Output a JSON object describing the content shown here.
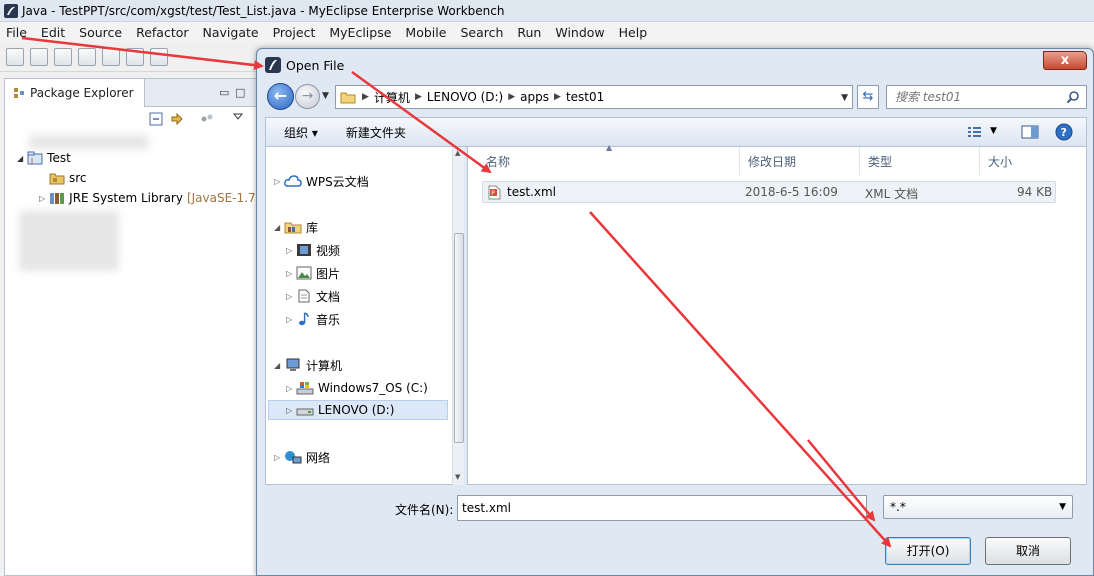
{
  "window": {
    "title": "Java - TestPPT/src/com/xgst/test/Test_List.java - MyEclipse Enterprise Workbench"
  },
  "menubar": {
    "items": [
      "File",
      "Edit",
      "Source",
      "Refactor",
      "Navigate",
      "Project",
      "MyEclipse",
      "Mobile",
      "Search",
      "Run",
      "Window",
      "Help"
    ]
  },
  "package_explorer": {
    "tab_label": "Package Explorer",
    "project": "Test",
    "src": "src",
    "jre": "JRE System Library",
    "jre_version": "[JavaSE-1.7"
  },
  "dialog": {
    "title": "Open File",
    "close_glyph": "x",
    "breadcrumbs": [
      "计算机",
      "LENOVO (D:)",
      "apps",
      "test01"
    ],
    "search_placeholder": "搜索 test01",
    "commands": {
      "organize": "组织 ▾",
      "new_folder": "新建文件夹"
    },
    "nav": {
      "wps": "WPS云文档",
      "libraries": "库",
      "videos": "视频",
      "pictures": "图片",
      "documents": "文档",
      "music": "音乐",
      "computer": "计算机",
      "drive_c": "Windows7_OS (C:)",
      "drive_d": "LENOVO (D:)",
      "network": "网络"
    },
    "columns": {
      "name": "名称",
      "modified": "修改日期",
      "type": "类型",
      "size": "大小"
    },
    "files": [
      {
        "name": "test.xml",
        "modified": "2018-6-5 16:09",
        "type": "XML 文档",
        "size": "94 KB"
      }
    ],
    "filename_label": "文件名(N):",
    "filename_value": "test.xml",
    "filetype_value": "*.*",
    "open_button": "打开(O)",
    "cancel_button": "取消"
  },
  "colors": {
    "annotation_arrow": "#e8383b",
    "dialog_bg": "#dfe8f3",
    "selection": "#dce8f7",
    "close_button": "#c74a32"
  }
}
